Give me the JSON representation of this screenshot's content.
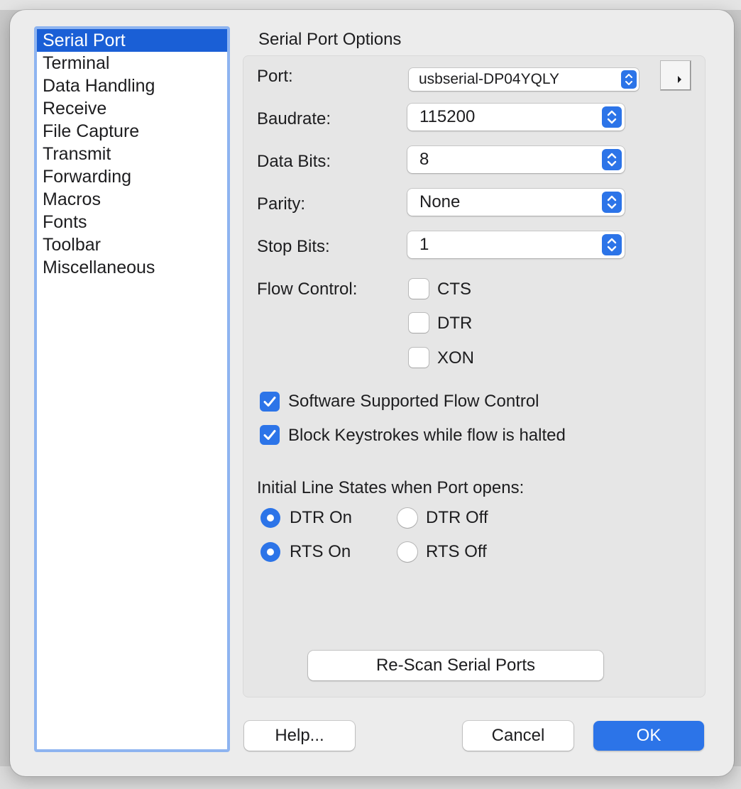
{
  "sidebar": {
    "items": [
      {
        "label": "Serial Port",
        "selected": true
      },
      {
        "label": "Terminal"
      },
      {
        "label": "Data Handling"
      },
      {
        "label": "Receive"
      },
      {
        "label": "File Capture"
      },
      {
        "label": "Transmit"
      },
      {
        "label": "Forwarding"
      },
      {
        "label": "Macros"
      },
      {
        "label": "Fonts"
      },
      {
        "label": "Toolbar"
      },
      {
        "label": "Miscellaneous"
      }
    ]
  },
  "group": {
    "title": "Serial Port Options"
  },
  "fields": {
    "port": {
      "label": "Port:",
      "value": "usbserial-DP04YQLY"
    },
    "baudrate": {
      "label": "Baudrate:",
      "value": "115200"
    },
    "data_bits": {
      "label": "Data Bits:",
      "value": "8"
    },
    "parity": {
      "label": "Parity:",
      "value": "None"
    },
    "stop_bits": {
      "label": "Stop Bits:",
      "value": "1"
    }
  },
  "flow_control": {
    "label": "Flow Control:",
    "options": [
      {
        "label": "CTS",
        "checked": false
      },
      {
        "label": "DTR",
        "checked": false
      },
      {
        "label": "XON",
        "checked": false
      }
    ]
  },
  "options": {
    "software_flow": {
      "label": "Software Supported Flow Control",
      "checked": true
    },
    "block_keystrokes": {
      "label": "Block Keystrokes while flow is halted",
      "checked": true
    }
  },
  "line_states": {
    "title": "Initial Line States when Port opens:",
    "dtr_on": {
      "label": "DTR On",
      "selected": true
    },
    "dtr_off": {
      "label": "DTR Off",
      "selected": false
    },
    "rts_on": {
      "label": "RTS On",
      "selected": true
    },
    "rts_off": {
      "label": "RTS Off",
      "selected": false
    }
  },
  "buttons": {
    "rescan": "Re-Scan Serial Ports",
    "help": "Help...",
    "cancel": "Cancel",
    "ok": "OK"
  },
  "icons": {
    "disclosure": "triangle-right-icon",
    "stepper": "up-down-chevron-icon",
    "checkmark": "checkmark-icon"
  },
  "colors": {
    "accent": "#2c74e8",
    "selection": "#1a5fd6",
    "sidebar_focus_ring": "#8eb4f0",
    "window_background": "#ececec"
  }
}
